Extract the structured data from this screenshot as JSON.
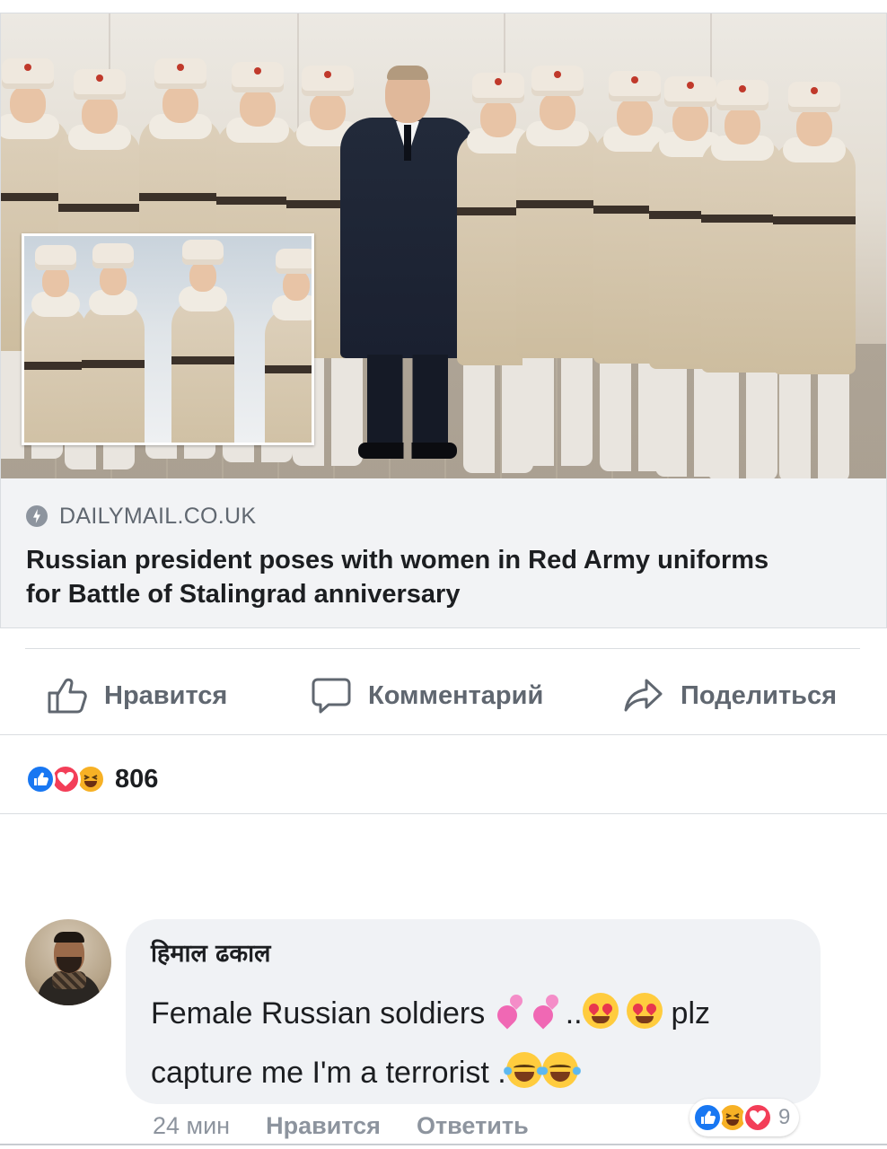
{
  "link_preview": {
    "domain": "DAILYMAIL.CO.UK",
    "headline": "Russian president poses with women in Red Army uniforms for Battle of Stalingrad anniversary"
  },
  "actions": {
    "like_label": "Нравится",
    "comment_label": "Комментарий",
    "share_label": "Поделиться"
  },
  "reactions": {
    "icons": [
      "like-icon",
      "love-icon",
      "haha-icon"
    ],
    "count": "806"
  },
  "comment": {
    "author": "हिमाल ढकाल",
    "text_line1": "Female Russian  soldiers",
    "text_line1_mid": "..",
    "text_line1_end": "plz",
    "text_line2": "capture  me I'm a terrorist .",
    "emojis": [
      "two-hearts",
      "two-hearts",
      "heart-eyes",
      "heart-eyes",
      "tears-of-joy",
      "tears-of-joy"
    ],
    "time": "24 мин",
    "like_label": "Нравится",
    "reply_label": "Ответить",
    "reaction_icons": [
      "like-icon",
      "haha-icon",
      "love-icon"
    ],
    "reaction_count": "9"
  },
  "colors": {
    "facebook_blue": "#1877f2",
    "love_red": "#f33e58",
    "haha_yellow": "#f7b125",
    "muted_text": "#606770",
    "bubble_bg": "#f0f2f5"
  }
}
